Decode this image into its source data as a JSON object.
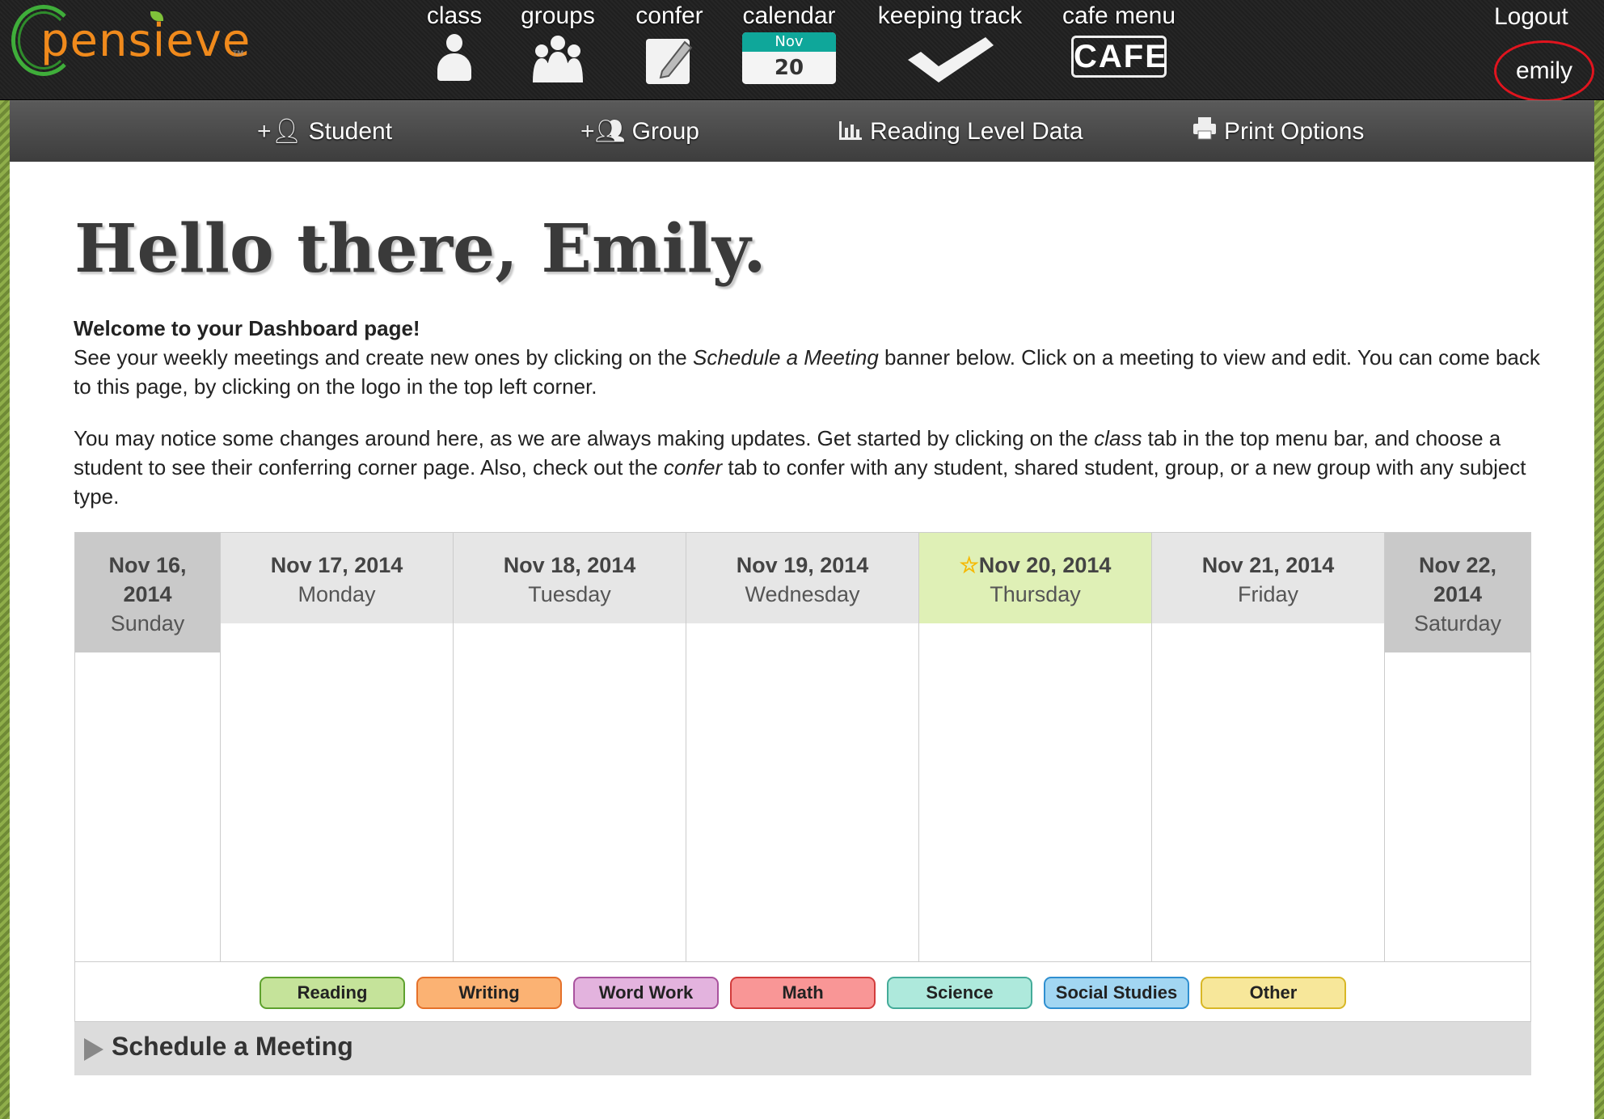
{
  "brand": {
    "name": "pensieve",
    "tm": "TM"
  },
  "nav": {
    "class": "class",
    "groups": "groups",
    "confer": "confer",
    "calendar": "calendar",
    "calendar_month": "Nov",
    "calendar_day": "20",
    "keeping_track": "keeping track",
    "cafe_menu": "cafe menu",
    "cafe_text": "CAFE",
    "logout": "Logout",
    "user": "emily"
  },
  "subnav": {
    "student": "Student",
    "group": "Group",
    "reading_level": "Reading Level Data",
    "print_options": "Print Options"
  },
  "page": {
    "greeting": "Hello there, Emily.",
    "welcome_title": "Welcome to your Dashboard page!",
    "p1_a": "See your weekly meetings and create new ones by clicking on the ",
    "p1_em": "Schedule a Meeting",
    "p1_b": " banner below. Click on a meeting to view and edit. You can come back to this page, by clicking on the logo in the top left corner.",
    "p2_a": "You may notice some changes around here, as we are always making updates. Get started by clicking on the ",
    "p2_em1": "class",
    "p2_b": " tab in the top menu bar, and choose a student to see their conferring corner page. Also, check out the ",
    "p2_em2": "confer",
    "p2_c": " tab to confer with any student, shared student, group, or a new group with any subject type."
  },
  "calendar": {
    "days": [
      {
        "date": "Nov 16, 2014",
        "day": "Sunday"
      },
      {
        "date": "Nov 17, 2014",
        "day": "Monday"
      },
      {
        "date": "Nov 18, 2014",
        "day": "Tuesday"
      },
      {
        "date": "Nov 19, 2014",
        "day": "Wednesday"
      },
      {
        "date": "Nov 20, 2014",
        "day": "Thursday"
      },
      {
        "date": "Nov 21, 2014",
        "day": "Friday"
      },
      {
        "date": "Nov 22, 2014",
        "day": "Saturday"
      }
    ],
    "today_star": "☆"
  },
  "legend": [
    {
      "label": "Reading",
      "bg": "#c5e39a",
      "border": "#5ea12e"
    },
    {
      "label": "Writing",
      "bg": "#fbb273",
      "border": "#e5712a"
    },
    {
      "label": "Word Work",
      "bg": "#e3b3de",
      "border": "#a9539e"
    },
    {
      "label": "Math",
      "bg": "#f99696",
      "border": "#d23c3c"
    },
    {
      "label": "Science",
      "bg": "#aee9dc",
      "border": "#44ab99"
    },
    {
      "label": "Social Studies",
      "bg": "#a2d6f2",
      "border": "#2f8fd0"
    },
    {
      "label": "Other",
      "bg": "#f7e79a",
      "border": "#d8b726"
    }
  ],
  "schedule": {
    "label": "Schedule a Meeting"
  }
}
